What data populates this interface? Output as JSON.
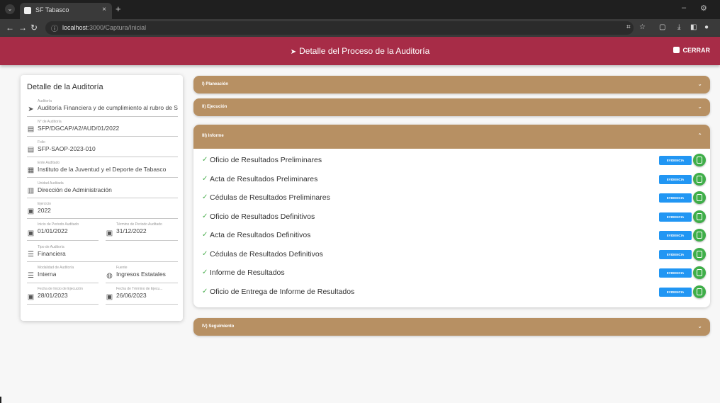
{
  "browser": {
    "tab_title": "SF Tabasco",
    "url_host": "localhost",
    "url_path": ":3000/Captura/Inicial"
  },
  "header": {
    "title": "Detalle del Proceso de la Auditoría",
    "close_label": "CERRAR"
  },
  "card": {
    "title": "Detalle de la Auditoría",
    "fields": [
      {
        "label": "Auditoría",
        "value": "Auditoría Financiera y de cumplimiento al rubro de S...",
        "icon": "chevron-right-icon"
      },
      {
        "label": "N° de Auditoría",
        "value": "SFP/DGCAP/A2/AUD/01/2022",
        "icon": "id-card-icon"
      },
      {
        "label": "Folio",
        "value": "SFP-SAOP-2023-010",
        "icon": "id-card-icon"
      },
      {
        "label": "Ente Auditado",
        "value": "Instituto de la Juventud y el Deporte de Tabasco",
        "icon": "building-icon"
      },
      {
        "label": "Unidad Auditada",
        "value": "Dirección de Administración",
        "icon": "office-icon"
      },
      {
        "label": "Ejercicio",
        "value": "2022",
        "icon": "calendar-icon"
      },
      {
        "label": "Inicio de Periodo Auditado",
        "value": "01/01/2022",
        "icon": "calendar-icon"
      },
      {
        "label": "Término de Periodo Auditado",
        "value": "31/12/2022",
        "icon": "calendar-icon"
      },
      {
        "label": "Tipo de Auditoría",
        "value": "Financiera",
        "icon": "list-icon"
      },
      {
        "label": "Modalidad de Auditoría",
        "value": "Interna",
        "icon": "list-icon"
      },
      {
        "label": "Fuente",
        "value": "Ingresos Estatales",
        "icon": "globe-icon"
      },
      {
        "label": "Fecha de Inicio de Ejecución",
        "value": "28/01/2023",
        "icon": "calendar-icon"
      },
      {
        "label": "Fecha de Término de Ejecu...",
        "value": "26/06/2023",
        "icon": "calendar-icon"
      }
    ]
  },
  "sections": {
    "s1": "I) Planeación",
    "s2": "II) Ejecución",
    "s3": "III) Informe",
    "s4": "IV) Seguimiento"
  },
  "informe_items": [
    "Oficio de Resultados Preliminares",
    "Acta de Resultados Preliminares",
    "Cédulas de Resultados Preliminares",
    "Oficio de Resultados Definitivos",
    "Acta de Resultados Definitivos",
    "Cédulas de Resultados Definitivos",
    "Informe de Resultados",
    "Oficio de Entrega de Informe de Resultados"
  ],
  "evidence_label": "EVIDENCIA",
  "colors": {
    "header": "#a72c47",
    "accordion": "#b79063",
    "evidence_button": "#2196f3",
    "doc_button": "#3fae49",
    "check": "#4caf50"
  }
}
